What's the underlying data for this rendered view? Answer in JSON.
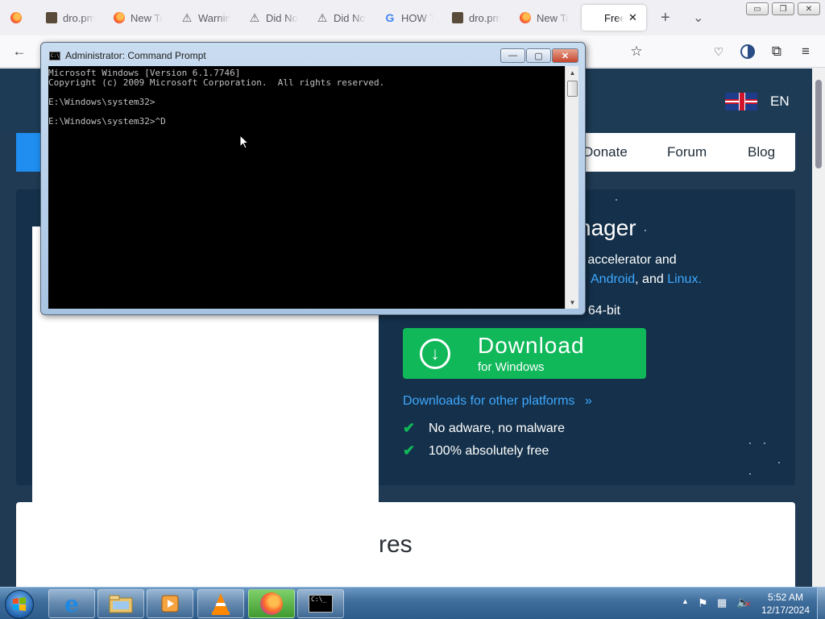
{
  "browser": {
    "tabs": [
      {
        "label": "dro.pm",
        "icon": "firefox-icon"
      },
      {
        "label": "New Ta",
        "icon": "firefox-icon"
      },
      {
        "label": "Warnin",
        "icon": "warning-icon"
      },
      {
        "label": "Did No",
        "icon": "warning-icon"
      },
      {
        "label": "Did No",
        "icon": "warning-icon"
      },
      {
        "label": "HOW T",
        "icon": "google-icon"
      },
      {
        "label": "dro.pm",
        "icon": "firefox-icon"
      },
      {
        "label": "New Ta",
        "icon": "firefox-icon"
      },
      {
        "label": "Free",
        "icon": "blank-icon",
        "active": true
      }
    ],
    "new_tab_symbol": "+",
    "list_all_tabs_symbol": "⌄",
    "window_buttons": {
      "minimize": "▭",
      "maximize": "❐",
      "close": "✕"
    }
  },
  "page": {
    "language": "EN",
    "menu": [
      "Donate",
      "Forum",
      "Blog"
    ],
    "hero_title_fragment": "nager",
    "hero_desc_line1": "d accelerator and",
    "hero_platforms_prefix": "Android",
    "hero_platforms_mid": ", and ",
    "hero_platforms_suffix": "Linux",
    "hero_platforms_end": ".",
    "hero_bitness": "/ 64-bit",
    "download_title": "Download",
    "download_subtitle": "for Windows",
    "other_platforms": "Downloads for other platforms",
    "features": [
      "No adware, no malware",
      "100% absolutely free"
    ],
    "features_heading_fragment": "res"
  },
  "cmd": {
    "title": "Administrator: Command Prompt",
    "output": "Microsoft Windows [Version 6.1.7746]\nCopyright (c) 2009 Microsoft Corporation.  All rights reserved.\n\nE:\\Windows\\system32>\n\nE:\\Windows\\system32>^D",
    "buttons": {
      "minimize": "—",
      "maximize": "▢",
      "close": "✕"
    }
  },
  "taskbar": {
    "time": "5:52 AM",
    "date": "12/17/2024",
    "pinned": [
      "internet-explorer-icon",
      "explorer-icon",
      "media-player-icon",
      "vlc-icon",
      "firefox-icon",
      "command-prompt-icon"
    ],
    "tray_expand": "▲"
  }
}
